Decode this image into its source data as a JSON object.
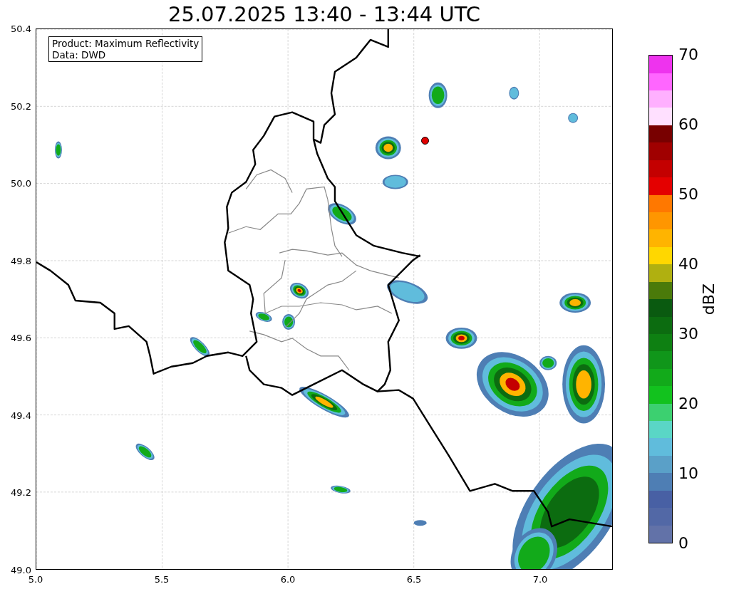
{
  "title": "25.07.2025 13:40 - 13:44 UTC",
  "info_box": {
    "lines": [
      "Product: Maximum Reflectivity",
      "Data: DWD"
    ]
  },
  "map": {
    "x_ticks": [
      "5.0",
      "5.5",
      "6.0",
      "6.5",
      "7.0"
    ],
    "y_ticks": [
      "50.4",
      "50.2",
      "50.0",
      "49.8",
      "49.6",
      "49.4",
      "49.2",
      "49.0"
    ]
  },
  "colorbar": {
    "label": "dBZ",
    "ticks": [
      "70",
      "60",
      "50",
      "40",
      "30",
      "20",
      "10",
      "0"
    ],
    "bins": [
      {
        "color": "#6272a8"
      },
      {
        "color": "#5268a6"
      },
      {
        "color": "#4860a4"
      },
      {
        "color": "#4e7eb4"
      },
      {
        "color": "#5aa0c8"
      },
      {
        "color": "#60bcdc"
      },
      {
        "color": "#5ad6c6"
      },
      {
        "color": "#3cd070"
      },
      {
        "color": "#12c21e"
      },
      {
        "color": "#12aa1a"
      },
      {
        "color": "#10961a"
      },
      {
        "color": "#0e8012"
      },
      {
        "color": "#0c6c10"
      },
      {
        "color": "#0a5a10"
      },
      {
        "color": "#4a7a0a"
      },
      {
        "color": "#b0b010"
      },
      {
        "color": "#ffd700"
      },
      {
        "color": "#ffb400"
      },
      {
        "color": "#ff9600"
      },
      {
        "color": "#ff7800"
      },
      {
        "color": "#e40000"
      },
      {
        "color": "#c40000"
      },
      {
        "color": "#a00000"
      },
      {
        "color": "#780000"
      },
      {
        "color": "#ffe0ff"
      },
      {
        "color": "#ffb0ff"
      },
      {
        "color": "#ff66ff"
      },
      {
        "color": "#ee33ee"
      }
    ]
  }
}
